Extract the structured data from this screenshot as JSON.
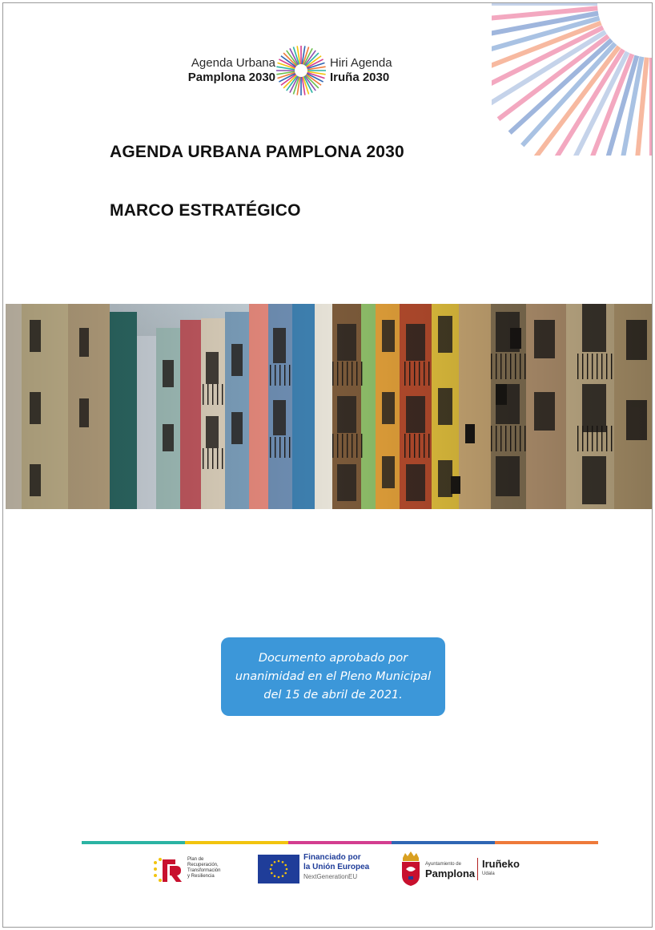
{
  "header": {
    "logo_left_line1": "Agenda Urbana",
    "logo_left_line2": "Pamplona 2030",
    "logo_right_line1": "Hiri Agenda",
    "logo_right_line2": "Iruña 2030"
  },
  "document": {
    "title": "AGENDA URBANA PAMPLONA 2030",
    "subtitle": "MARCO ESTRATÉGICO"
  },
  "approval_note": {
    "text": "Documento aprobado por\nunanimidad en el Pleno Municipal\ndel 15 de abril de 2021."
  },
  "footer": {
    "prtr_lines": [
      "Plan de",
      "Recuperación,",
      "Transformación",
      "y Resiliencia"
    ],
    "eu_line1": "Financiado por",
    "eu_line2": "la Unión Europea",
    "eu_line3": "NextGenerationEU",
    "ayto_small": "Ayuntamiento de",
    "ayto_big": "Pamplona",
    "iruneko_big": "Iruñeko",
    "iruneko_small": "Udala"
  },
  "colors": {
    "accent_blue": "#3c97d9",
    "eu_blue": "#1f3d99",
    "rule_colors": [
      "#2bb3a3",
      "#f2c40f",
      "#d33d8f",
      "#2f66b3",
      "#ee7a3a"
    ]
  }
}
